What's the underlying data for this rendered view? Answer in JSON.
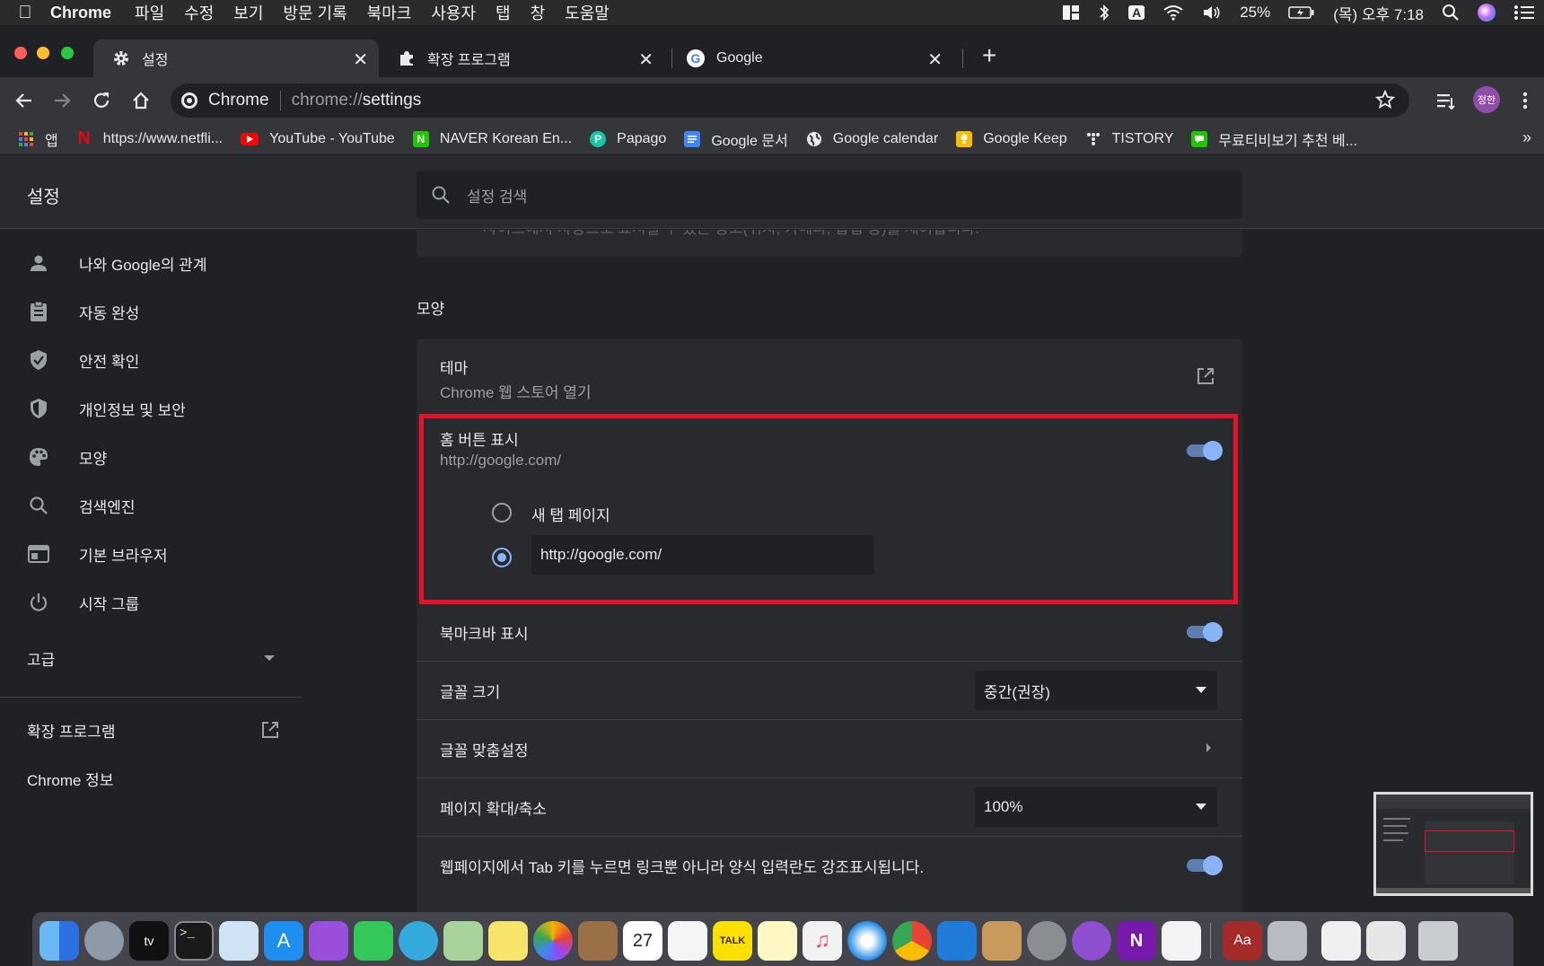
{
  "menubar": {
    "app": "Chrome",
    "items": [
      "파일",
      "수정",
      "보기",
      "방문 기록",
      "북마크",
      "사용자",
      "탭",
      "창",
      "도움말"
    ],
    "input_indicator": "A",
    "battery": "25%",
    "clock": "(목) 오후 7:18"
  },
  "tabs": [
    {
      "title": "설정",
      "icon": "gear-icon",
      "active": true
    },
    {
      "title": "확장 프로그램",
      "icon": "puzzle-icon",
      "active": false
    },
    {
      "title": "Google",
      "icon": "google-icon",
      "active": false
    }
  ],
  "tab_close": "✕",
  "new_tab": "+",
  "omnibox": {
    "site": "Chrome",
    "scheme": "chrome://",
    "path": "settings"
  },
  "profile_initials": "정한",
  "bookmarks": [
    {
      "label": "앱",
      "icon": "apps-grid-icon",
      "color": "#ea4335"
    },
    {
      "label": "https://www.netfli...",
      "icon": "netflix-icon",
      "color": "#e50914"
    },
    {
      "label": "YouTube - YouTube",
      "icon": "youtube-icon",
      "color": "#ff0000"
    },
    {
      "label": "NAVER Korean En...",
      "icon": "naver-icon",
      "color": "#1ec800"
    },
    {
      "label": "Papago",
      "icon": "papago-icon",
      "color": "#18c5a6"
    },
    {
      "label": "Google 문서",
      "icon": "docs-icon",
      "color": "#4285f4"
    },
    {
      "label": "Google calendar",
      "icon": "globe-icon",
      "color": "#e8eaed"
    },
    {
      "label": "Google Keep",
      "icon": "keep-icon",
      "color": "#fbbc04"
    },
    {
      "label": "TISTORY",
      "icon": "tistory-icon",
      "color": "#e8eaed"
    },
    {
      "label": "무료티비보기 추천 베...",
      "icon": "chat-icon",
      "color": "#1ec800"
    }
  ],
  "bookmarks_overflow": "»",
  "settings": {
    "title": "설정",
    "search_placeholder": "설정 검색",
    "sidebar": [
      {
        "label": "나와 Google의 관계",
        "icon": "person-icon"
      },
      {
        "label": "자동 완성",
        "icon": "clipboard-icon"
      },
      {
        "label": "안전 확인",
        "icon": "shield-check-icon"
      },
      {
        "label": "개인정보 및 보안",
        "icon": "shield-icon"
      },
      {
        "label": "모양",
        "icon": "palette-icon"
      },
      {
        "label": "검색엔진",
        "icon": "search-icon"
      },
      {
        "label": "기본 브라우저",
        "icon": "browser-icon"
      },
      {
        "label": "시작 그룹",
        "icon": "power-icon"
      }
    ],
    "advanced": "고급",
    "extensions": "확장 프로그램",
    "about": "Chrome 정보",
    "cutoff_text": "사이트에서 자동으로 표시될 수 있는 광고(위치, 카메라, 팝업 등)를 제어합니다.",
    "appearance_heading": "모양",
    "theme": {
      "title": "테마",
      "subtitle": "Chrome 웹 스토어 열기"
    },
    "home_button": {
      "title": "홈 버튼 표시",
      "subtitle": "http://google.com/",
      "enabled": true,
      "option_newtab": "새 탭 페이지",
      "custom_url": "http://google.com/",
      "selected": "custom"
    },
    "bookmarks_bar": {
      "title": "북마크바 표시",
      "enabled": true
    },
    "font_size": {
      "title": "글꼴 크기",
      "value": "중간(권장)"
    },
    "customize_fonts": {
      "title": "글꼴 맞춤설정"
    },
    "page_zoom": {
      "title": "페이지 확대/축소",
      "value": "100%"
    },
    "tab_highlight": {
      "title": "웹페이지에서 Tab 키를 누르면 링크뿐 아니라 양식 입력란도 강조표시됩니다.",
      "enabled": true
    }
  },
  "highlight_color": "#e8102a",
  "accent_color": "#8ab4f8"
}
